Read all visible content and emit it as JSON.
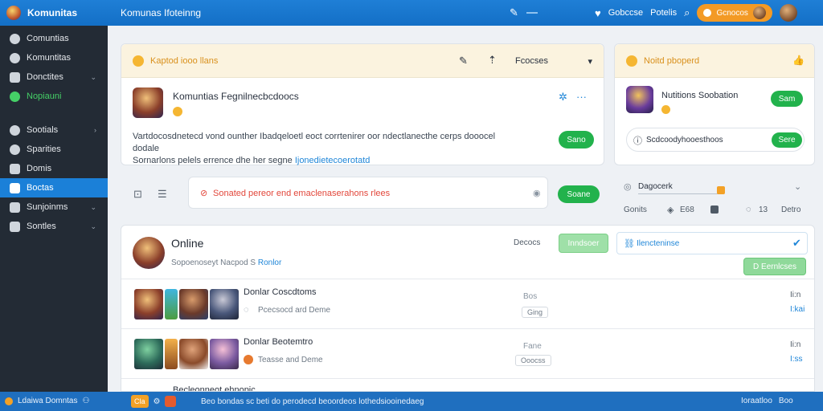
{
  "app": {
    "brand": "Komunitas",
    "page_title": "Komunas Ifoteinng"
  },
  "topbar": {
    "user1": "Gobccse",
    "user2": "Potelis",
    "pill_label": "Gcnocos"
  },
  "sidebar": {
    "items": [
      {
        "label": "Comuntias",
        "icon": "circle-icon"
      },
      {
        "label": "Komuntitas",
        "icon": "circle-icon"
      },
      {
        "label": "Donctites",
        "icon": "folder-icon",
        "chevron": true
      },
      {
        "label": "Nopiauni",
        "icon": "dot-icon",
        "highlight": "green"
      },
      {
        "label": "Sootials",
        "icon": "gear-icon",
        "chevron": true
      },
      {
        "label": "Sparities",
        "icon": "gear-icon"
      },
      {
        "label": "Domis",
        "icon": "calendar-icon"
      },
      {
        "label": "Boctas",
        "icon": "box-icon",
        "active": true
      },
      {
        "label": "Sunjoinms",
        "icon": "grid-icon",
        "chevron": true
      },
      {
        "label": "Sontles",
        "icon": "layers-icon",
        "chevron": true
      }
    ]
  },
  "main_card": {
    "header_title": "Kaptod iooo llans",
    "select_value": "Fcocses",
    "title": "Komuntias Fegnilnecbcdoocs",
    "desc_line1": "Vartdocosdnetecd vond ounther Ibadqeloetl eoct corrtenirer oor ndectlanecthe cerps dooocel dodale",
    "desc_line2": "Sornarlons pelels errence dhe her segne",
    "desc_link": "Ijonedietecoerotatd",
    "button": "Sano"
  },
  "side_card": {
    "header_title": "Noitd pboperd",
    "title": "Nutitions Soobation",
    "button": "Sam",
    "search_text": "Scdcoodyhooesthoos",
    "search_button": "Sere"
  },
  "alert_bar": {
    "message": "Sonated pereor end emaclenaserahons rlees",
    "button": "Soane"
  },
  "stats": {
    "label": "Dagocerk",
    "c1_label": "Gonits",
    "c2": "E68",
    "c3": "13",
    "c4": "Detro"
  },
  "online": {
    "title": "Online",
    "subtitle": "Sopoenoseyt Nacpod S",
    "subtitle_link": "Ronlor",
    "filter_label": "Decocs",
    "filter_button": "Inndsoer",
    "input_text": "Ilencteninse",
    "action_button": "D Eernlcses"
  },
  "rows": [
    {
      "title": "Donlar Coscdtoms",
      "sub": "Pcecsocd ard Deme",
      "status": "Bos",
      "tag": "Ging",
      "right1": "Ii:n",
      "right2": "I:kai"
    },
    {
      "title": "Donlar Beotemtro",
      "sub": "Teasse and Deme",
      "status": "Fane",
      "tag": "Ooocss",
      "right1": "Ii:n",
      "right2": "I:ss"
    },
    {
      "title": "Becleonneot ehnopic",
      "sub": "",
      "status": "",
      "tag": "",
      "right1": "",
      "right2": ""
    }
  ],
  "bottombar": {
    "left_label": "Ldaiwa Domntas",
    "chip": "Cla",
    "message": "Beo bondas sc beti do perodecd beoordeos lothedsiooinedaeg",
    "right1": "Ioraatloo",
    "right2": "Boo"
  },
  "colors": {
    "accent": "#1b80d8",
    "topbar": "#1f7fd6",
    "sidebar": "#232b35",
    "green": "#22b24c",
    "orange": "#f39a25"
  }
}
